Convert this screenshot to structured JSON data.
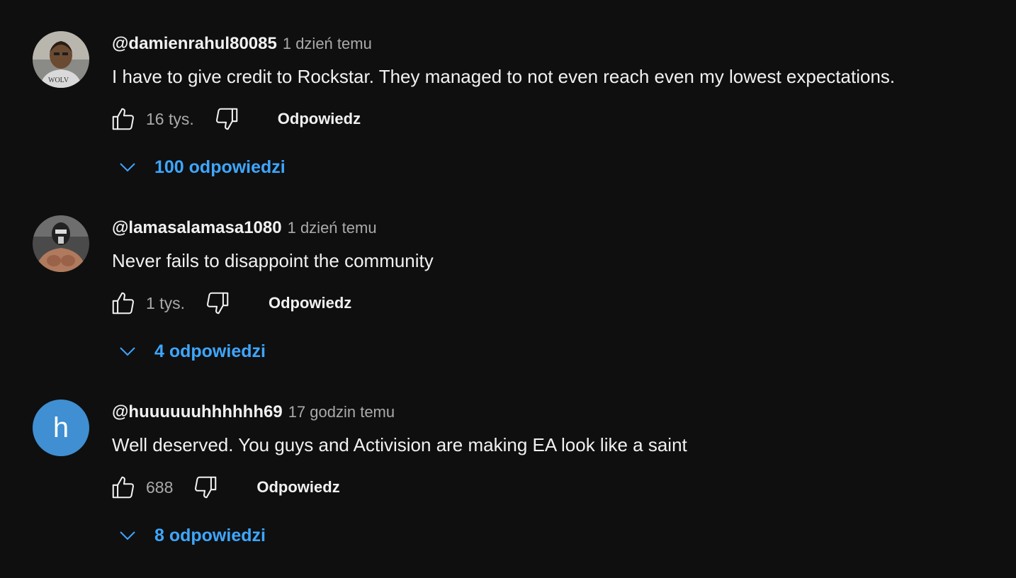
{
  "comments": [
    {
      "author": "@damienrahul80085",
      "time": "1 dzień temu",
      "text": "I have to give credit to Rockstar. They managed to not even reach even my lowest expectations.",
      "likes": "16 tys.",
      "reply_label": "Odpowiedz",
      "replies_label": "100 odpowiedzi",
      "avatar": "photo-avatar"
    },
    {
      "author": "@lamasalamasa1080",
      "time": "1 dzień temu",
      "text": "Never fails to disappoint the community",
      "likes": "1 tys.",
      "reply_label": "Odpowiedz",
      "replies_label": "4 odpowiedzi",
      "avatar": "photo-avatar"
    },
    {
      "author": "@huuuuuuhhhhhh69",
      "time": "17 godzin temu",
      "text": "Well deserved. You guys and Activision are making EA look like a saint",
      "likes": "688",
      "reply_label": "Odpowiedz",
      "replies_label": "8 odpowiedzi",
      "avatar": "letter-avatar",
      "avatar_letter": "h",
      "avatar_color": "#3f8fd2"
    }
  ],
  "colors": {
    "background": "#0f0f0f",
    "text": "#f1f1f1",
    "secondary_text": "#aaaaaa",
    "link": "#3ea6ff"
  },
  "icons": {
    "like": "thumbs-up-icon",
    "dislike": "thumbs-down-icon",
    "expand": "chevron-down-icon"
  }
}
